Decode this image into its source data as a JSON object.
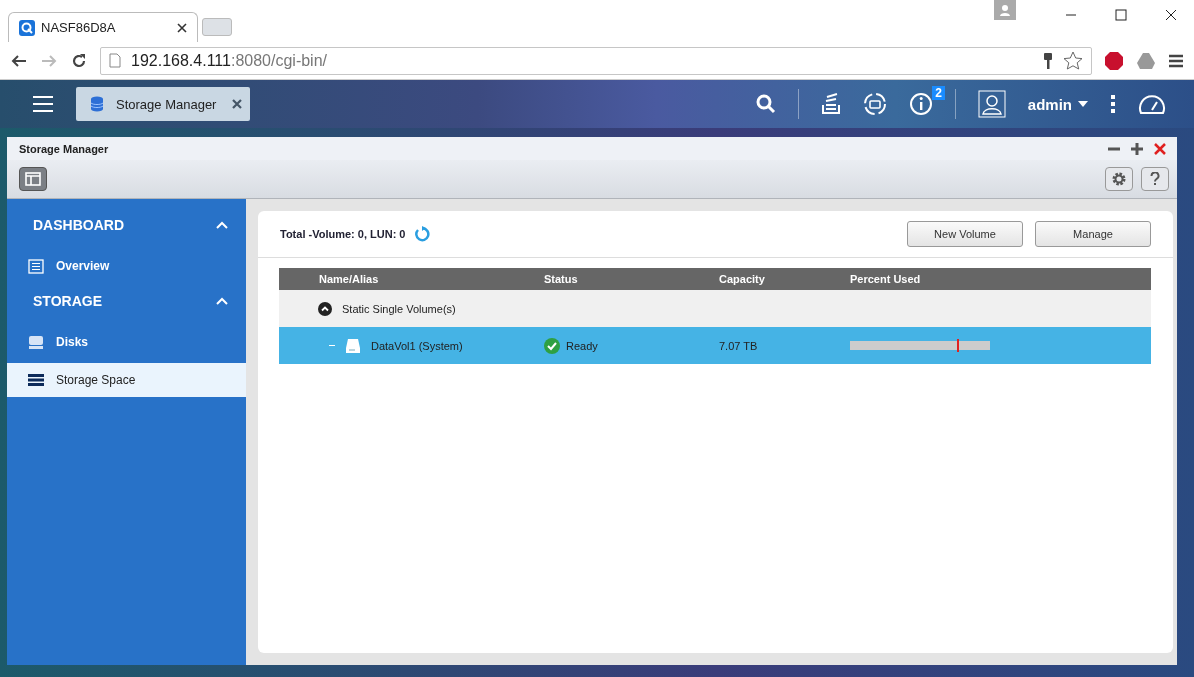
{
  "browser": {
    "tabs": [
      {
        "title": "NASF86D8A",
        "selected": true
      }
    ],
    "url_host": "192.168.4.111",
    "url_path": ":8080/cgi-bin/"
  },
  "topbar": {
    "apps": [
      {
        "label": "Storage Manager"
      }
    ],
    "notification_count": "2",
    "user": "admin"
  },
  "window": {
    "title": "Storage Manager"
  },
  "sidebar": {
    "sections": [
      {
        "title": "DASHBOARD",
        "expanded": true,
        "items": [
          {
            "label": "Overview",
            "kind": "list",
            "selected": false
          }
        ]
      },
      {
        "title": "STORAGE",
        "expanded": true,
        "items": [
          {
            "label": "Disks",
            "kind": "disk",
            "selected": false
          },
          {
            "label": "Storage Space",
            "kind": "stack",
            "selected": true
          }
        ]
      }
    ]
  },
  "summary": "Total -Volume: 0, LUN: 0",
  "buttons": [
    "New Volume",
    "Manage"
  ],
  "table": {
    "columns": [
      "Name/Alias",
      "Status",
      "Capacity",
      "Percent Used"
    ],
    "groups": [
      {
        "label": "Static Single Volume(s)",
        "expanded": true,
        "rows": [
          {
            "name": "DataVol1 (System)",
            "status": "Ready",
            "capacity": "7.07 TB",
            "level": 0,
            "selected": true
          }
        ]
      }
    ]
  }
}
